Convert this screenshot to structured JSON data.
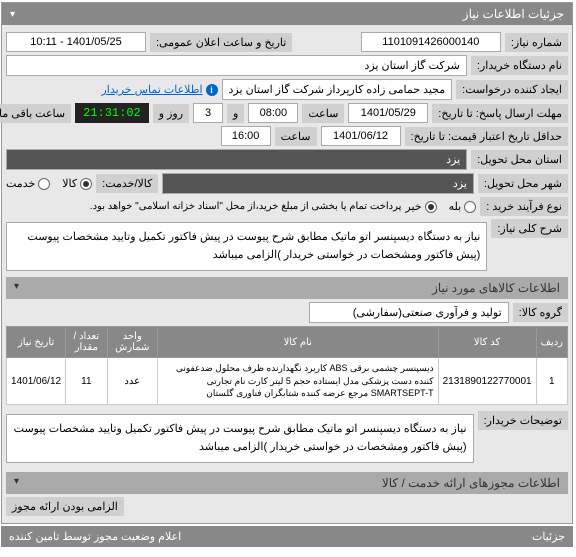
{
  "panel": {
    "title": "جزئیات اطلاعات نیاز"
  },
  "fields": {
    "need_number_label": "شماره نیاز:",
    "need_number": "1101091426000140",
    "announce_label": "تاریخ و ساعت اعلان عمومی:",
    "announce_value": "1401/05/25 - 10:11",
    "buyer_org_label": "نام دستگاه خریدار:",
    "buyer_org": "شرکت گاز استان یزد",
    "requester_label": "ایجاد کننده درخواست:",
    "requester": "مجید حمامی زاده کارپرداز شرکت گاز استان یزد",
    "contact_link": "اطلاعات تماس خریدار",
    "deadline_label": "مهلت ارسال پاسخ: تا تاریخ:",
    "deadline_date": "1401/05/29",
    "time_label": "ساعت",
    "deadline_time": "08:00",
    "and_label": "و",
    "days": "3",
    "days_label": "روز و",
    "countdown": "21:31:02",
    "remaining_label": "ساعت باقی مانده",
    "validity_label": "حداقل تاریخ اعتبار قیمت: تا تاریخ:",
    "validity_date": "1401/06/12",
    "validity_time": "16:00",
    "req_province_label": "استان محل تحویل:",
    "req_province": "یزد",
    "req_city_label": "شهر محل تحویل:",
    "req_city": "یزد",
    "goods_service_label": "کالا/خدمت:",
    "option_goods": "کالا",
    "option_service": "خدمت",
    "purchase_type_label": "نوع فرآیند خرید :",
    "payment_note": "پرداخت تمام یا بخشی از مبلغ خرید،از محل \"اسناد خزانه اسلامی\" خواهد بود.",
    "option_yes": "بله",
    "option_no": "خیر",
    "need_desc_label": "شرح کلی نیاز:",
    "need_desc": "نیاز به دستگاه دیسپنسر اتو ماتیک مطابق شرح پیوست در پیش فاکتور تکمیل وتایید مشخصات پیوست (پیش فاکتور ومشخصات در خواستی خریدار )الزامی میباشد"
  },
  "items_section": {
    "header": "اطلاعات کالاهای مورد نیاز",
    "group_label": "گروه کالا:",
    "group_value": "تولید و فرآوری صنعتی(سفارشی)"
  },
  "table": {
    "headers": {
      "row": "ردیف",
      "code": "کد کالا",
      "name": "نام کالا",
      "unit": "واحد شمارش",
      "qty": "تعداد / مقدار",
      "date": "تاریخ نیاز"
    },
    "rows": [
      {
        "row": "1",
        "code": "2131890122770001",
        "name": "دیسپنسر چشمی برقی ABS کاربرد نگهدارنده ظرف محلول ضدعفونی کننده دست پزشکی مدل ایستاده حجم 5 لیتر کارت نام تجارتی SMARTSEPT-T مرجع عرضه کننده شتابگران فناوری گلستان",
        "unit": "عدد",
        "qty": "11",
        "date": "1401/06/12"
      }
    ]
  },
  "buyer_notes": {
    "label": "توضیحات خریدار:",
    "text": "نیاز به دستگاه دیسپنسر اتو ماتیک مطابق شرح پیوست در پیش فاکتور تکمیل وتایید مشخصات پیوست (پیش فاکتور ومشخصات در خواستی خریدار )الزامی میباشد"
  },
  "bottom_section": {
    "header": "اطلاعات مجوزهای ارائه خدمت / کالا",
    "mandatory_label": "الزامی بودن ارائه مجوز",
    "footer_right": "جزئیات",
    "footer_left": "اعلام وضعیت مجوز توسط تامین کننده"
  }
}
